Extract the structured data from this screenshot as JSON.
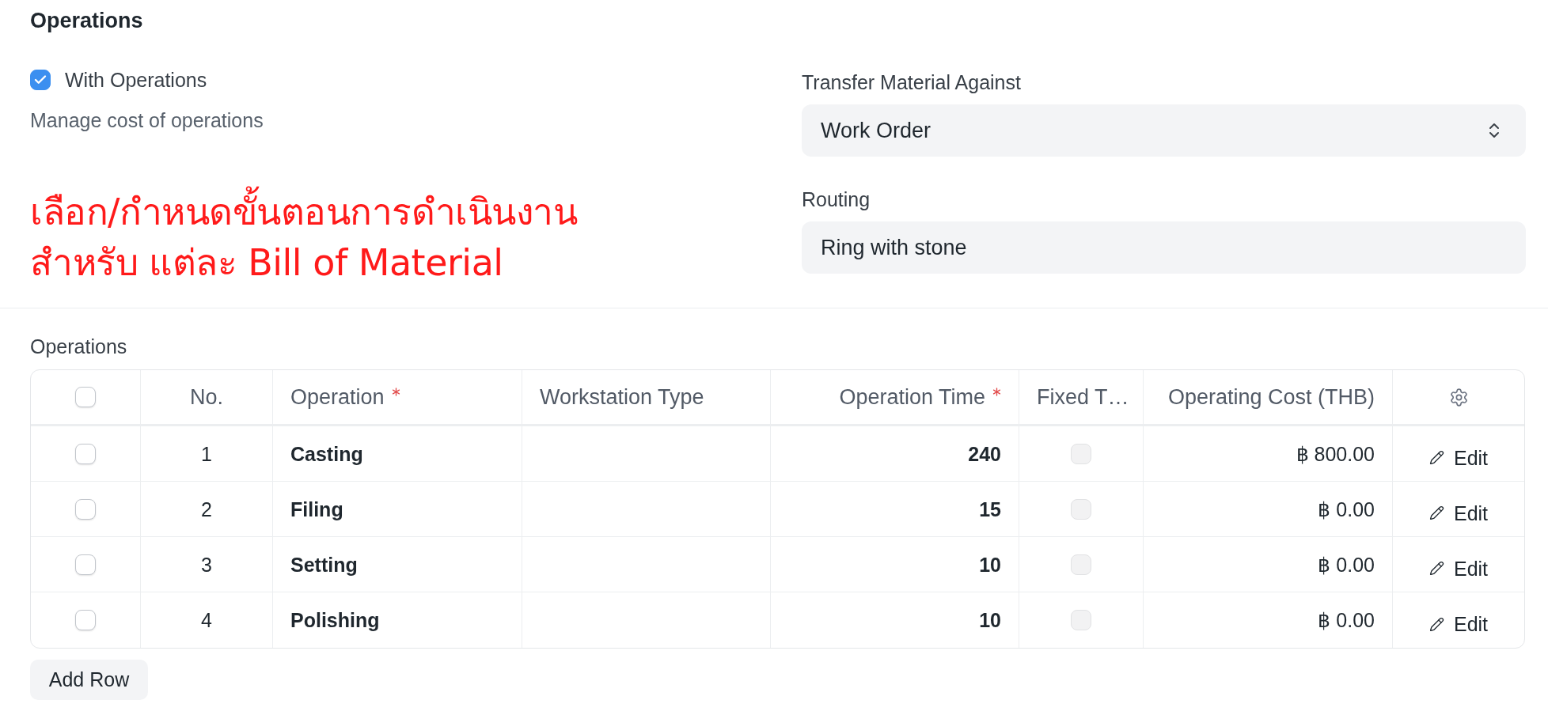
{
  "section": {
    "title": "Operations"
  },
  "with_operations": {
    "label": "With Operations",
    "checked": true,
    "description": "Manage cost of operations"
  },
  "annotation": {
    "lines": [
      "เลือก/กำหนดขั้นตอนการดำเนินงาน",
      "สำหรับ แต่ละ Bill of Material"
    ]
  },
  "transfer_material_against": {
    "label": "Transfer Material Against",
    "value": "Work Order"
  },
  "routing": {
    "label": "Routing",
    "value": "Ring with stone"
  },
  "operations_table": {
    "label": "Operations",
    "select_all": false,
    "columns": [
      {
        "label": "No.",
        "kind": "index",
        "required": false
      },
      {
        "label": "Operation",
        "kind": "link",
        "required": true
      },
      {
        "label": "Workstation Type",
        "kind": "link",
        "required": false
      },
      {
        "label": "Operation Time",
        "kind": "number",
        "required": true
      },
      {
        "label": "Fixed T…",
        "kind": "check",
        "required": false
      },
      {
        "label": "Operating Cost (THB)",
        "kind": "currency",
        "required": false
      }
    ],
    "rows": [
      {
        "selected": false,
        "no": "1",
        "operation": "Casting",
        "operation_time": "240",
        "fixed_time": false,
        "operating_cost": "฿ 800.00",
        "action": "Edit"
      },
      {
        "selected": false,
        "no": "2",
        "operation": "Filing",
        "operation_time": "15",
        "fixed_time": false,
        "operating_cost": "฿ 0.00",
        "action": "Edit"
      },
      {
        "selected": false,
        "no": "3",
        "operation": "Setting",
        "operation_time": "10",
        "fixed_time": false,
        "operating_cost": "฿ 0.00",
        "action": "Edit"
      },
      {
        "selected": false,
        "no": "4",
        "operation": "Polishing",
        "operation_time": "10",
        "fixed_time": false,
        "operating_cost": "฿ 0.00",
        "action": "Edit"
      }
    ],
    "add_row": "Add Row"
  }
}
